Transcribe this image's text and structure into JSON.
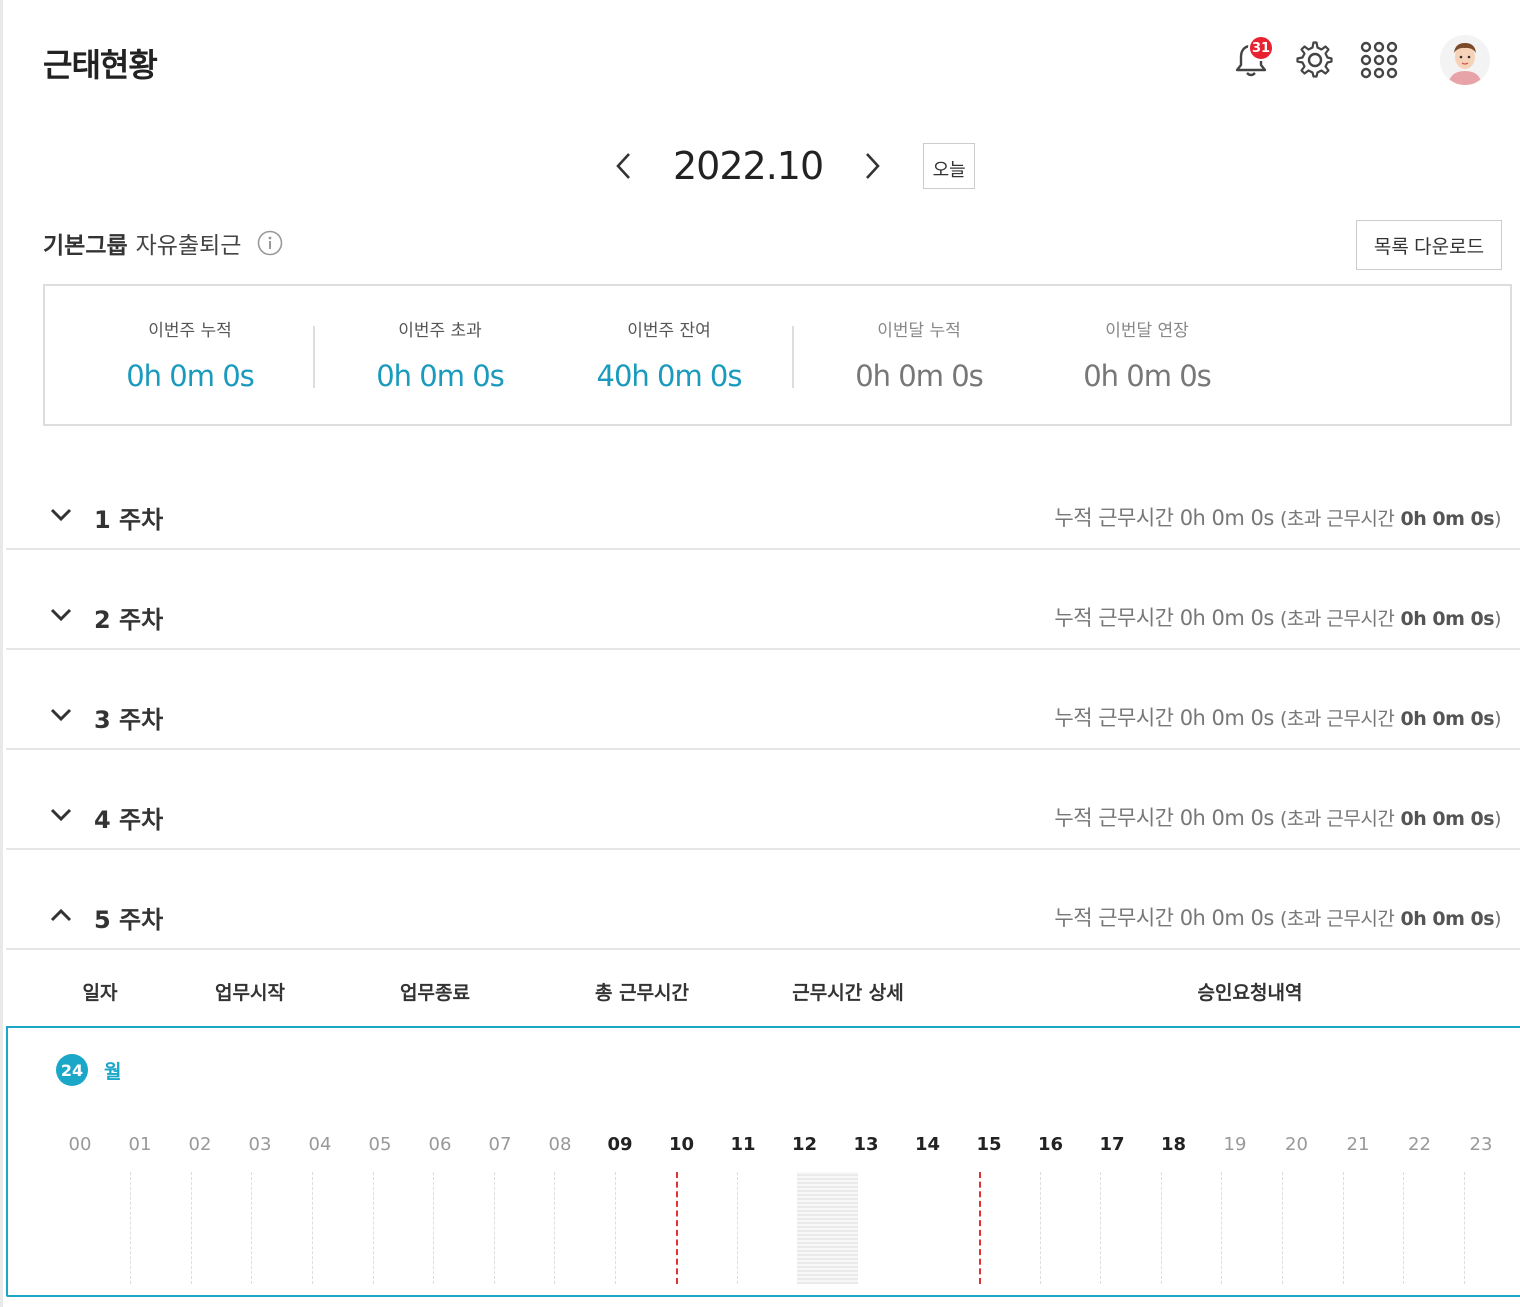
{
  "page": {
    "title": "근태현황"
  },
  "header": {
    "notification_count": "31",
    "icons": [
      "bell-icon",
      "gear-icon",
      "apps-grid-icon",
      "avatar"
    ]
  },
  "month_nav": {
    "label": "2022.10",
    "today_label": "오늘"
  },
  "group": {
    "name": "기본그룹",
    "type": "자유출퇴근",
    "download_label": "목록 다운로드"
  },
  "summary": [
    {
      "label": "이번주 누적",
      "value": "0h 0m 0s"
    },
    {
      "label": "이번주 초과",
      "value": "0h 0m 0s"
    },
    {
      "label": "이번주 잔여",
      "value": "40h 0m 0s"
    },
    {
      "label": "이번달 누적",
      "value": "0h 0m 0s"
    },
    {
      "label": "이번달 연장",
      "value": "0h 0m 0s"
    }
  ],
  "weeks": [
    {
      "title": "1 주차",
      "sum_label": "누적 근무시간",
      "sum_value": "0h 0m 0s",
      "over_label": "(초과 근무시간",
      "over_value": "0h 0m 0s",
      "over_close": ")"
    },
    {
      "title": "2 주차",
      "sum_label": "누적 근무시간",
      "sum_value": "0h 0m 0s",
      "over_label": "(초과 근무시간",
      "over_value": "0h 0m 0s",
      "over_close": ")"
    },
    {
      "title": "3 주차",
      "sum_label": "누적 근무시간",
      "sum_value": "0h 0m 0s",
      "over_label": "(초과 근무시간",
      "over_value": "0h 0m 0s",
      "over_close": ")"
    },
    {
      "title": "4 주차",
      "sum_label": "누적 근무시간",
      "sum_value": "0h 0m 0s",
      "over_label": "(초과 근무시간",
      "over_value": "0h 0m 0s",
      "over_close": ")"
    },
    {
      "title": "5 주차",
      "sum_label": "누적 근무시간",
      "sum_value": "0h 0m 0s",
      "over_label": "(초과 근무시간",
      "over_value": "0h 0m 0s",
      "over_close": ")"
    }
  ],
  "table": {
    "headers": [
      "일자",
      "업무시작",
      "업무종료",
      "총 근무시간",
      "근무시간 상세",
      "승인요청내역"
    ]
  },
  "day": {
    "date": "24",
    "weekday": "월",
    "hours": [
      "00",
      "01",
      "02",
      "03",
      "04",
      "05",
      "06",
      "07",
      "08",
      "09",
      "10",
      "11",
      "12",
      "13",
      "14",
      "15",
      "16",
      "17",
      "18",
      "19",
      "20",
      "21",
      "22",
      "23"
    ]
  },
  "colors": {
    "accent": "#1aa7c8",
    "value_teal": "#1a9bbd",
    "badge": "#e8222f",
    "marker": "#e23333"
  }
}
